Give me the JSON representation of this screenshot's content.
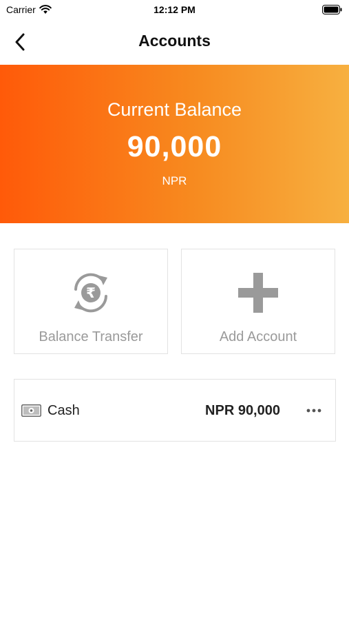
{
  "status_bar": {
    "carrier": "Carrier",
    "time": "12:12 PM",
    "wifi_icon": "wifi-icon",
    "battery_icon": "battery-icon"
  },
  "nav": {
    "title": "Accounts",
    "back_icon": "chevron-left-icon"
  },
  "balance": {
    "label": "Current Balance",
    "amount": "90,000",
    "currency": "NPR",
    "gradient_colors": [
      "#ff5a09",
      "#f78a1f",
      "#f7b040"
    ]
  },
  "actions": [
    {
      "label": "Balance Transfer",
      "icon": "rupee-transfer-icon"
    },
    {
      "label": "Add Account",
      "icon": "plus-icon"
    }
  ],
  "accounts": [
    {
      "name": "Cash",
      "balance": "NPR 90,000",
      "icon": "cash-icon",
      "more_icon": "more-horizontal-icon"
    }
  ],
  "colors": {
    "icon_gray": "#9a9a9a",
    "border": "#e2e2e2"
  }
}
